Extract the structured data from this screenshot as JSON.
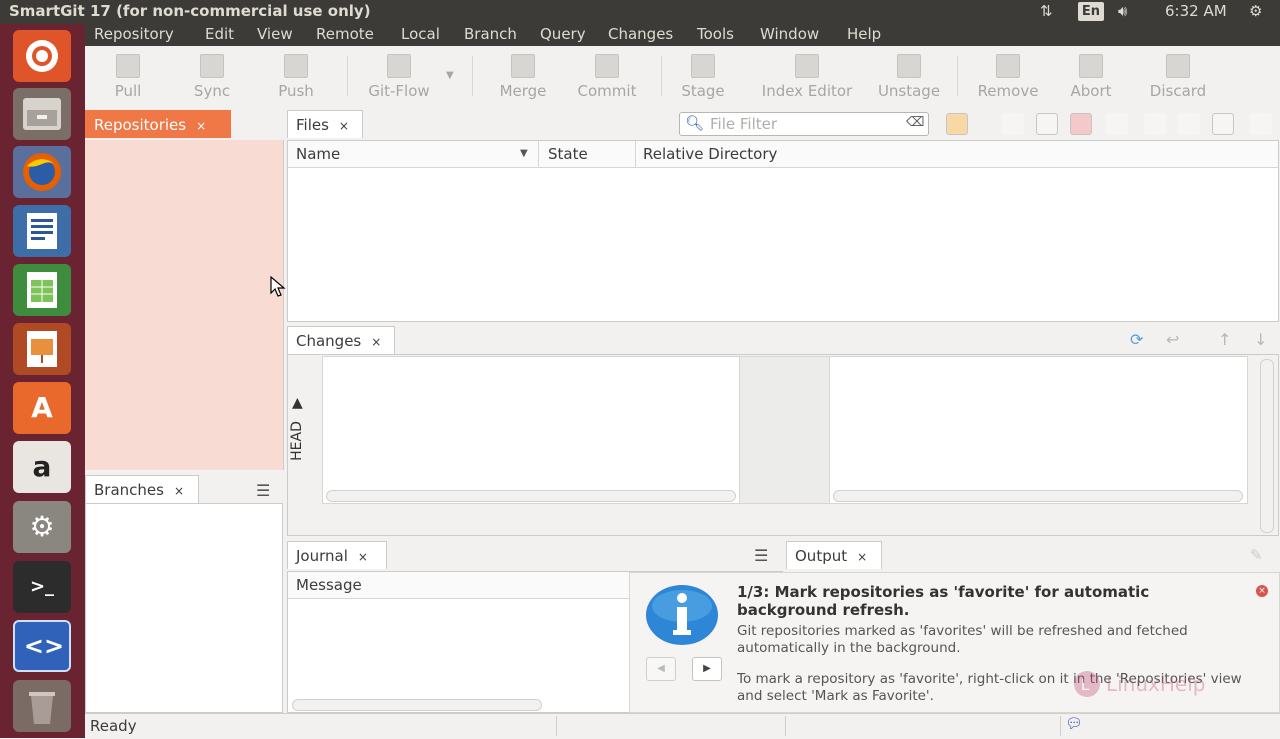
{
  "topbar": {
    "title": "SmartGit 17 (for non-commercial use only)",
    "network_icon": "network-arrows-icon",
    "keyboard": "En",
    "volume_icon": "volume-icon",
    "time": "6:32 AM",
    "settings_icon": "gear-icon"
  },
  "menubar": {
    "items": [
      "Repository",
      "Edit",
      "View",
      "Remote",
      "Local",
      "Branch",
      "Query",
      "Changes",
      "Tools",
      "Window",
      "Help"
    ]
  },
  "toolbar": {
    "pull": "Pull",
    "sync": "Sync",
    "push": "Push",
    "gitflow": "Git-Flow",
    "merge": "Merge",
    "commit": "Commit",
    "stage": "Stage",
    "index_editor": "Index Editor",
    "unstage": "Unstage",
    "remove": "Remove",
    "abort": "Abort",
    "discard": "Discard"
  },
  "repositories": {
    "tab": "Repositories",
    "close": "×"
  },
  "branches": {
    "tab": "Branches",
    "close": "×",
    "menu_icon": "hamburger-icon"
  },
  "files": {
    "tab": "Files",
    "close": "×",
    "filter_placeholder": "File Filter",
    "columns": [
      "Name",
      "State",
      "Relative Directory"
    ]
  },
  "changes": {
    "tab": "Changes",
    "close": "×",
    "head_label": "HEAD"
  },
  "journal": {
    "tab": "Journal",
    "close": "×",
    "column": "Message"
  },
  "output": {
    "tab": "Output",
    "close": "×"
  },
  "notification": {
    "title": "1/3: Mark repositories as 'favorite' for automatic background refresh.",
    "body1": "Git repositories marked as 'favorites' will be refreshed and fetched automatically in the background.",
    "body2": "To mark a repository as 'favorite', right-click on it in the 'Repositories' view and select 'Mark as Favorite'.",
    "info_icon": "info-icon",
    "watermark": "LinuxHelp"
  },
  "statusbar": {
    "text": "Ready"
  },
  "colors": {
    "accent": "#f07746",
    "repo_bg": "#f8dcd3",
    "launcher": "#6a2431",
    "topbar": "#3c3b37"
  }
}
